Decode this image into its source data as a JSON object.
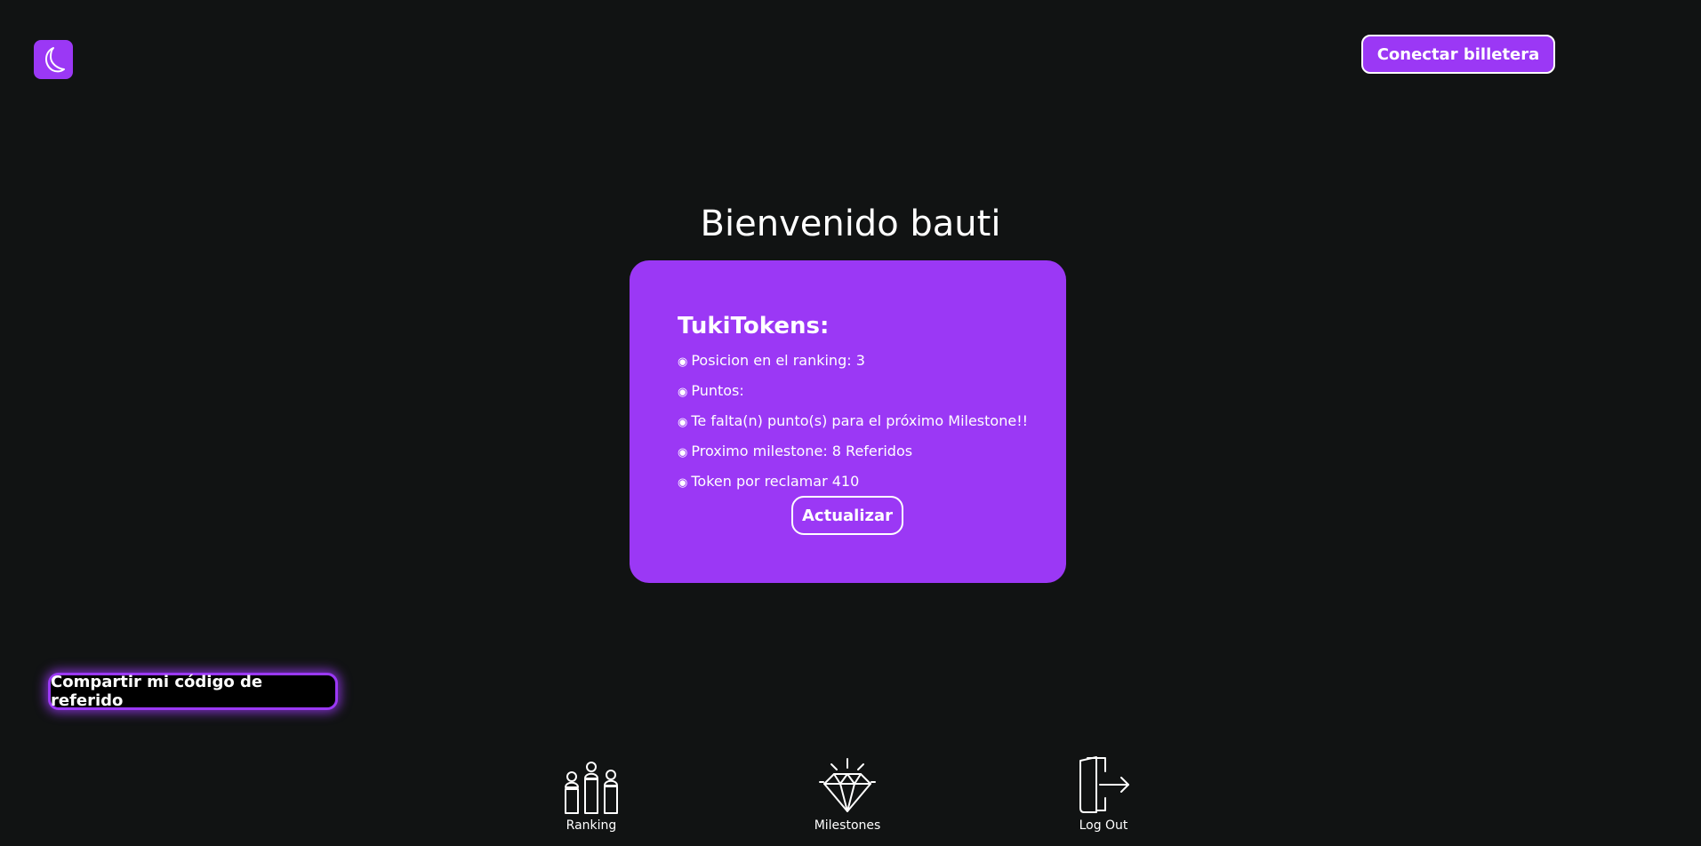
{
  "header": {
    "logo_icon": "moon-icon",
    "connect_label": "Conectar billetera"
  },
  "welcome": {
    "title": "Bienvenido bauti"
  },
  "card": {
    "title": "TukiTokens:",
    "bullet_glyph": "◉",
    "items": [
      "Posicion en el ranking: 3",
      "Puntos:",
      "Te falta(n) punto(s) para el próximo Milestone!!",
      "Proximo milestone: 8 Referidos",
      "Token por reclamar 410"
    ],
    "update_label": "Actualizar"
  },
  "referral": {
    "share_label": "Compartir mi código de referido"
  },
  "bottom_nav": {
    "items": [
      {
        "label": "Ranking",
        "icon": "podium-icon"
      },
      {
        "label": "Milestones",
        "icon": "diamond-icon"
      },
      {
        "label": "Log Out",
        "icon": "logout-door-icon"
      }
    ]
  },
  "colors": {
    "background": "#111313",
    "accent": "#9b38f5",
    "text": "#ffffff"
  }
}
